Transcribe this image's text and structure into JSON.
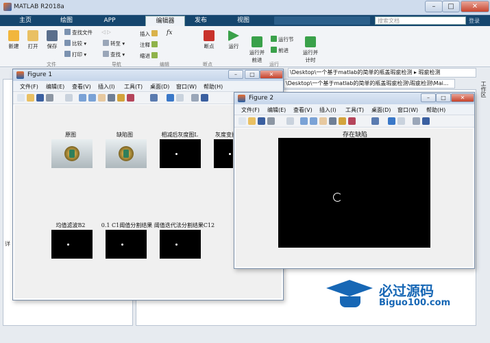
{
  "app": {
    "title": "MATLAB R2018a"
  },
  "tabs": [
    "主页",
    "绘图",
    "APP",
    "编辑器",
    "发布",
    "视图"
  ],
  "active_tab": "编辑器",
  "search": {
    "placeholder": "搜索文档"
  },
  "login": "登录",
  "ribbon": {
    "file": {
      "new": "新建",
      "open": "打开",
      "save": "保存",
      "find_files": "查找文件",
      "compare": "比较",
      "print": "打印",
      "group": "文件"
    },
    "navigate": {
      "goto": "转至",
      "find": "查找",
      "group": "导航"
    },
    "edit": {
      "insert": "插入",
      "comment": "注释",
      "indent": "缩进",
      "fx": "fx",
      "group": "编辑"
    },
    "breakpoints": {
      "label": "断点",
      "group": "断点"
    },
    "run": {
      "run": "运行",
      "run_advance": "运行并\n前进",
      "run_section": "运行节",
      "advance": "前进",
      "run_time": "运行并\n计时",
      "group": "运行"
    }
  },
  "path1": "\\Desktop\\一个基于matlab的简单的瓶盖瑕疵检测 ▸ 瑕疵检测",
  "path2": "\\Desktop\\一个基于matlab的简单的瓶盖瑕疵检测\\瑕疵检测\\Mai...",
  "side_right": "工作区",
  "side_left": "详",
  "figure1": {
    "title": "Figure 1",
    "menu": [
      "文件(F)",
      "编辑(E)",
      "查看(V)",
      "插入(I)",
      "工具(T)",
      "桌面(D)",
      "窗口(W)",
      "帮助(H)"
    ],
    "subplots": [
      "原图",
      "缺陷图",
      "相减后灰度图L",
      "灰度变换增",
      "均值滤波B2",
      "0.1 C1阈值分割结果",
      "阈值迭代法分割结果C12"
    ]
  },
  "figure2": {
    "title": "Figure 2",
    "menu": [
      "文件(F)",
      "编辑(E)",
      "查看(V)",
      "插入(I)",
      "工具(T)",
      "桌面(D)",
      "窗口(W)",
      "帮助(H)"
    ],
    "plot_title": "存在缺陷"
  },
  "watermark": {
    "brand": "必过源码",
    "url": "Biguo100.com"
  },
  "colors": {
    "tabbar": "#15466e",
    "accent": "#1767b5"
  }
}
